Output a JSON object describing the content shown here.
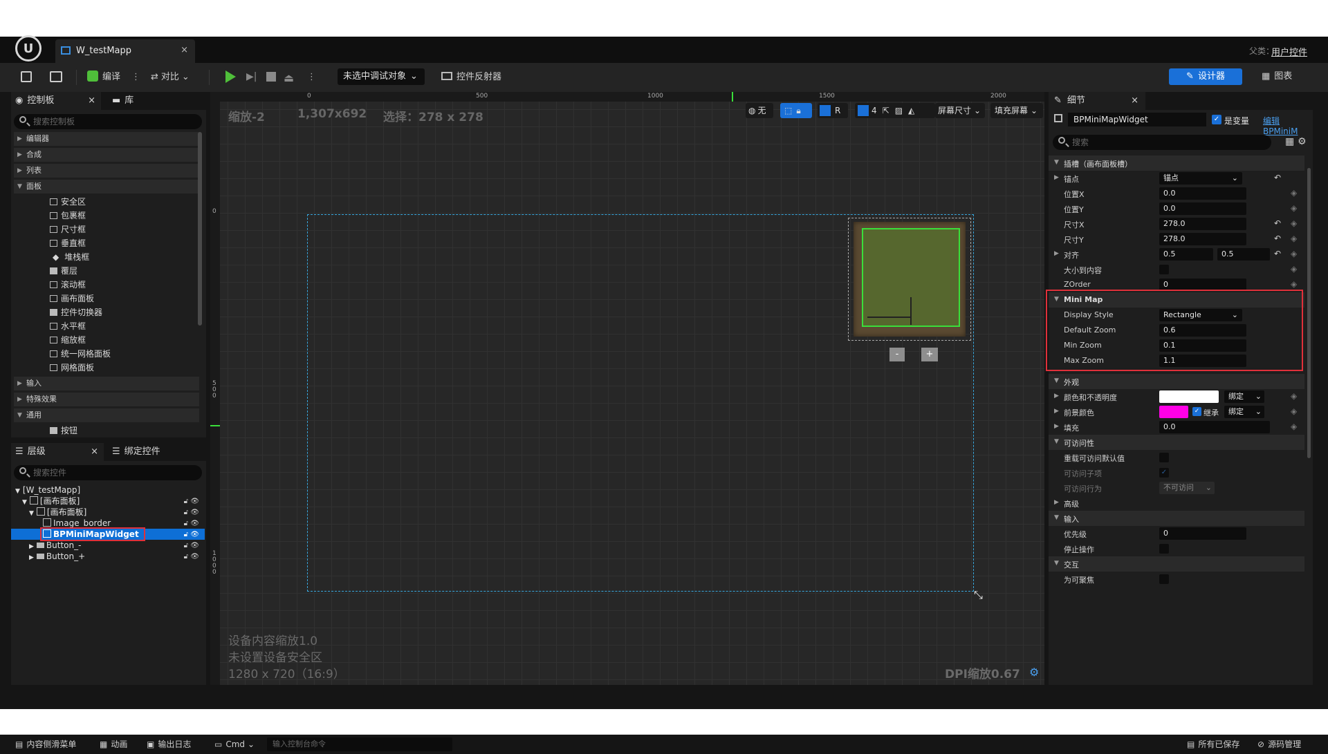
{
  "app": {
    "logo": "U"
  },
  "tab": {
    "title": "W_testMapp",
    "close": "×"
  },
  "parent": {
    "label": "父类：",
    "value": "用户控件"
  },
  "toolbar": {
    "compile": "编译",
    "diff": "对比",
    "debug_dropdown": "未选中调试对象",
    "reflector": "控件反射器",
    "designer": "设计器",
    "graph": "图表"
  },
  "palette": {
    "tab_label": "控制板",
    "lib_label": "库",
    "search_placeholder": "搜索控制板",
    "categories": [
      "编辑器",
      "合成",
      "列表",
      "面板"
    ],
    "items": [
      "安全区",
      "包裹框",
      "尺寸框",
      "垂直框",
      "堆栈框",
      "覆层",
      "滚动框",
      "画布面板",
      "控件切换器",
      "水平框",
      "缩放框",
      "统一网格面板",
      "网格面板"
    ],
    "categories2": [
      "输入",
      "特殊效果",
      "通用"
    ],
    "common_items": [
      "按钮"
    ]
  },
  "hierarchy": {
    "tab_label": "层级",
    "bind_label": "绑定控件",
    "search_placeholder": "搜索控件",
    "rows": [
      "[W_testMapp]",
      "[画布面板]",
      "[画布面板]",
      "Image_border",
      "BPMiniMapWidget",
      "Button_-",
      "Button_+"
    ]
  },
  "viewport": {
    "zoom": "缩放-2",
    "resolution": "1,307x692",
    "selection": "选择：278 x 278",
    "ruler_top": [
      "0",
      "500",
      "1000",
      "1500",
      "2000"
    ],
    "ruler_left": [
      "0",
      "500",
      "1000"
    ],
    "none_label": "无",
    "r_label": "R",
    "grid_num": "4",
    "screen_size": "屏幕尺寸",
    "fill_screen": "填充屏幕",
    "device_scale": "设备内容缩放1.0",
    "no_safe_zone": "未设置设备安全区",
    "device_res": "1280 x 720（16:9）",
    "dpi": "DPI缩放0.67",
    "minus": "-",
    "plus": "+"
  },
  "details": {
    "tab_label": "细节",
    "widget_name": "BPMiniMapWidget",
    "is_variable": "是变量",
    "edit_link": "编辑BPMiniM",
    "search_placeholder": "搜索",
    "slot_section": "插槽（画布面板槽）",
    "anchor_label": "锚点",
    "anchor_value": "锚点",
    "pos_x_label": "位置X",
    "pos_x": "0.0",
    "pos_y_label": "位置Y",
    "pos_y": "0.0",
    "size_x_label": "尺寸X",
    "size_x": "278.0",
    "size_y_label": "尺寸Y",
    "size_y": "278.0",
    "align_label": "对齐",
    "align_x": "0.5",
    "align_y": "0.5",
    "size_to_content": "大小到内容",
    "zorder_label": "ZOrder",
    "zorder": "0",
    "minimap_section": "Mini Map",
    "display_style_label": "Display Style",
    "display_style": "Rectangle",
    "default_zoom_label": "Default Zoom",
    "default_zoom": "0.6",
    "min_zoom_label": "Min Zoom",
    "min_zoom": "0.1",
    "max_zoom_label": "Max Zoom",
    "max_zoom": "1.1",
    "appearance_section": "外观",
    "color_opacity": "颜色和不透明度",
    "bind": "绑定",
    "foreground": "前景颜色",
    "inherit": "继承",
    "padding_label": "填充",
    "padding": "0.0",
    "accessibility_section": "可访问性",
    "override_access": "重载可访问默认值",
    "access_children": "可访问子项",
    "access_behavior": "可访问行为",
    "not_accessible": "不可访问",
    "advanced": "高级",
    "input_section": "输入",
    "priority_label": "优先级",
    "priority": "0",
    "stop_action": "停止操作",
    "interaction_section": "交互",
    "focusable": "为可聚焦"
  },
  "statusbar": {
    "content_drawer": "内容侧滑菜单",
    "animation": "动画",
    "output_log": "输出日志",
    "cmd": "Cmd",
    "console_placeholder": "输入控制台命令",
    "all_saved": "所有已保存",
    "source_control": "源码管理"
  },
  "colors": {
    "accent": "#1a70d8",
    "highlight": "#e0303a",
    "foreground_color": "#ff00e6",
    "minimap_border": "#3adf3a"
  }
}
